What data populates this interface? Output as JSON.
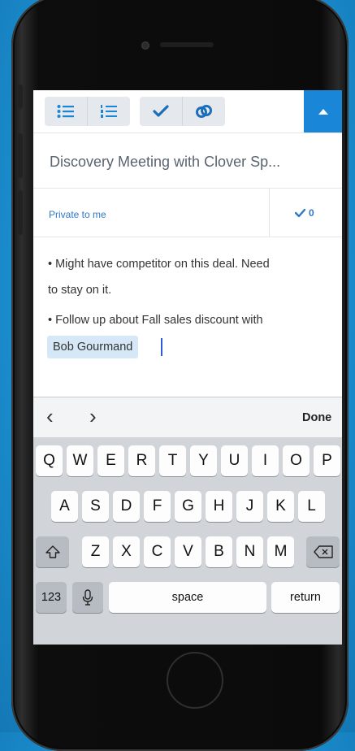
{
  "toolbar": {
    "icons": [
      "bulleted-list-icon",
      "numbered-list-icon",
      "checkmark-icon",
      "link-icon",
      "triangle-up-icon"
    ]
  },
  "note": {
    "title": "Discovery Meeting with Clover Sp...",
    "privacy": "Private to me",
    "check_count": "0",
    "lines": [
      "• Might have competitor on this deal. Need",
      "to stay on it.",
      "• Follow up about Fall sales discount with"
    ],
    "mention": "Bob Gourmand"
  },
  "accessory": {
    "prev": "‹",
    "next": "›",
    "done": "Done"
  },
  "keyboard": {
    "row1": [
      "Q",
      "W",
      "E",
      "R",
      "T",
      "Y",
      "U",
      "I",
      "O",
      "P"
    ],
    "row2": [
      "A",
      "S",
      "D",
      "F",
      "G",
      "H",
      "J",
      "K",
      "L"
    ],
    "row3": [
      "Z",
      "X",
      "C",
      "V",
      "B",
      "N",
      "M"
    ],
    "numbers": "123",
    "space": "space",
    "return": "return"
  },
  "colors": {
    "background": "#1b8fd0",
    "accent": "#1a86d8",
    "link": "#2f78c8",
    "mention_bg": "#d6e8f7"
  }
}
